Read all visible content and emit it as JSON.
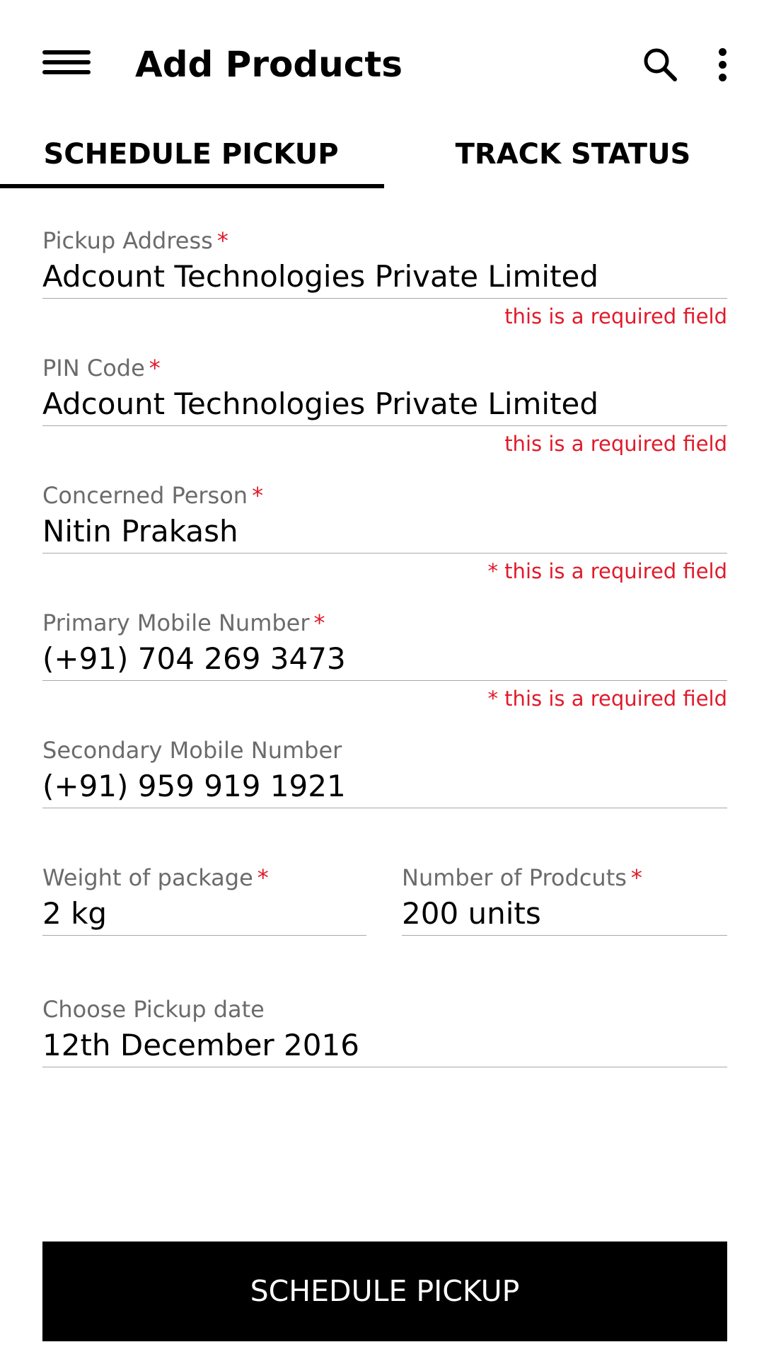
{
  "app_bar": {
    "title": "Add Products",
    "menu_icon": "hamburger-menu-icon",
    "search_icon": "search-icon",
    "more_icon": "more-vertical-icon"
  },
  "tabs": [
    {
      "label": "SCHEDULE PICKUP",
      "selected": true
    },
    {
      "label": "TRACK STATUS",
      "selected": false
    }
  ],
  "form": {
    "required_marker": "*",
    "pickup_address": {
      "label": "Pickup Address",
      "value": "Adcount Technologies Private Limited",
      "error": "this is a required field"
    },
    "pin_code": {
      "label": "PIN Code",
      "value": "Adcount Technologies Private Limited",
      "error": "this is a required field"
    },
    "concerned_person": {
      "label": "Concerned Person",
      "value": "Nitin Prakash",
      "error": "* this is a required field"
    },
    "primary_mobile": {
      "label": "Primary Mobile Number",
      "value": "(+91) 704 269 3473",
      "error": "* this is a required field"
    },
    "secondary_mobile": {
      "label": "Secondary Mobile Number",
      "value": "(+91) 959 919 1921"
    },
    "weight": {
      "label": "Weight of package",
      "value": "2 kg"
    },
    "num_products": {
      "label": "Number of Prodcuts",
      "value": "200 units"
    },
    "pickup_date": {
      "label": "Choose Pickup date",
      "value": "12th December 2016"
    }
  },
  "submit": {
    "label": "SCHEDULE PICKUP"
  },
  "colors": {
    "accent": "#000000",
    "error": "#e01a2a",
    "label": "#6b6b6b",
    "divider": "#a8a8a8"
  }
}
